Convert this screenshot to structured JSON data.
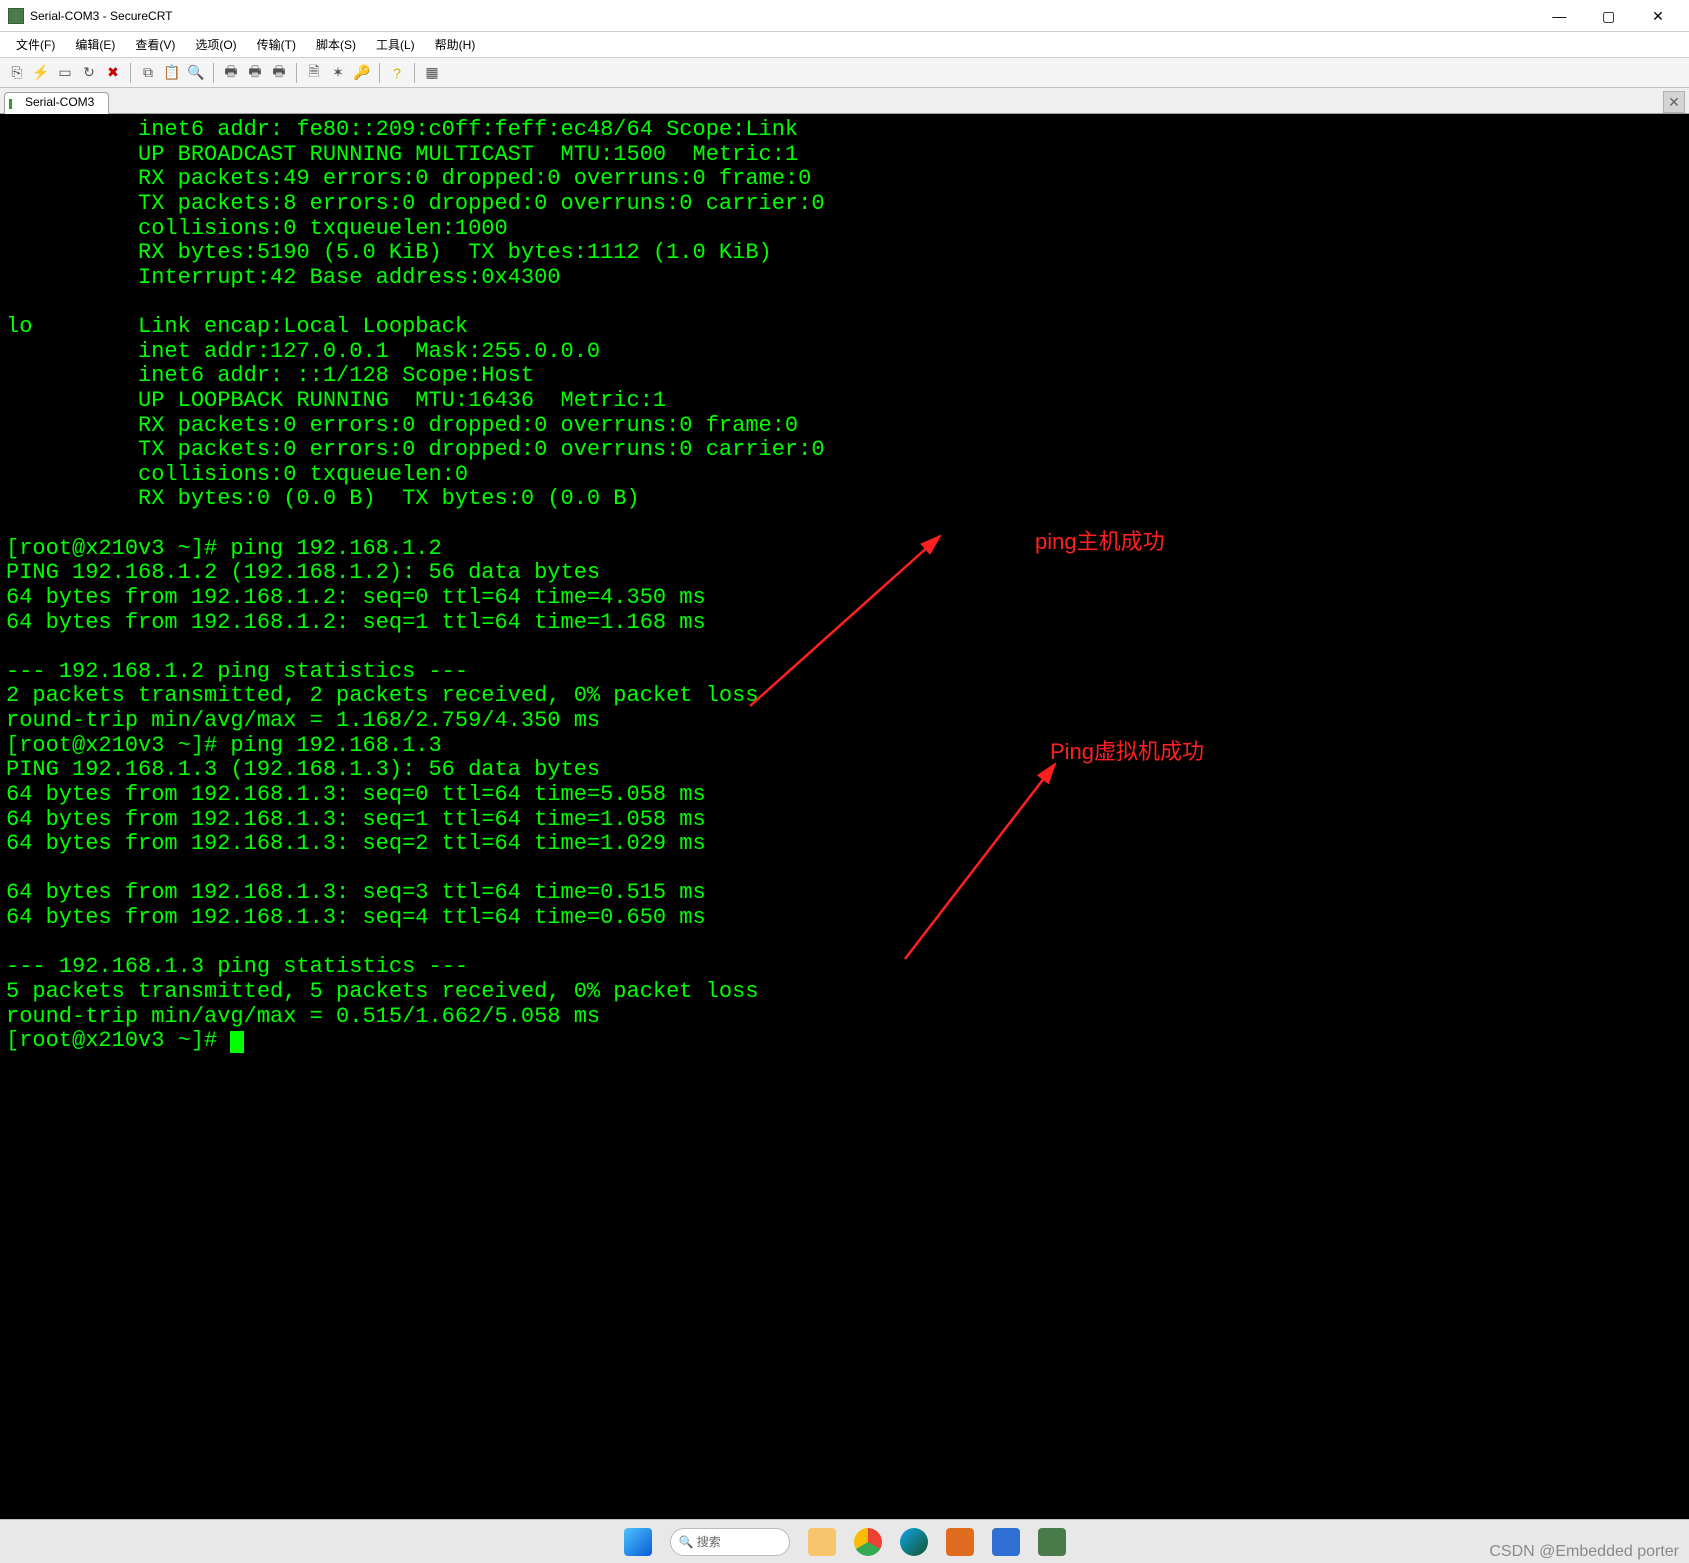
{
  "window": {
    "title": "Serial-COM3 - SecureCRT"
  },
  "menubar": [
    "文件(F)",
    "编辑(E)",
    "查看(V)",
    "选项(O)",
    "传输(T)",
    "脚本(S)",
    "工具(L)",
    "帮助(H)"
  ],
  "tab": {
    "label": "Serial-COM3"
  },
  "terminal_lines": [
    "          inet6 addr: fe80::209:c0ff:feff:ec48/64 Scope:Link",
    "          UP BROADCAST RUNNING MULTICAST  MTU:1500  Metric:1",
    "          RX packets:49 errors:0 dropped:0 overruns:0 frame:0",
    "          TX packets:8 errors:0 dropped:0 overruns:0 carrier:0",
    "          collisions:0 txqueuelen:1000",
    "          RX bytes:5190 (5.0 KiB)  TX bytes:1112 (1.0 KiB)",
    "          Interrupt:42 Base address:0x4300",
    "",
    "lo        Link encap:Local Loopback",
    "          inet addr:127.0.0.1  Mask:255.0.0.0",
    "          inet6 addr: ::1/128 Scope:Host",
    "          UP LOOPBACK RUNNING  MTU:16436  Metric:1",
    "          RX packets:0 errors:0 dropped:0 overruns:0 frame:0",
    "          TX packets:0 errors:0 dropped:0 overruns:0 carrier:0",
    "          collisions:0 txqueuelen:0",
    "          RX bytes:0 (0.0 B)  TX bytes:0 (0.0 B)",
    "",
    "[root@x210v3 ~]# ping 192.168.1.2",
    "PING 192.168.1.2 (192.168.1.2): 56 data bytes",
    "64 bytes from 192.168.1.2: seq=0 ttl=64 time=4.350 ms",
    "64 bytes from 192.168.1.2: seq=1 ttl=64 time=1.168 ms",
    "",
    "--- 192.168.1.2 ping statistics ---",
    "2 packets transmitted, 2 packets received, 0% packet loss",
    "round-trip min/avg/max = 1.168/2.759/4.350 ms",
    "[root@x210v3 ~]# ping 192.168.1.3",
    "PING 192.168.1.3 (192.168.1.3): 56 data bytes",
    "64 bytes from 192.168.1.3: seq=0 ttl=64 time=5.058 ms",
    "64 bytes from 192.168.1.3: seq=1 ttl=64 time=1.058 ms",
    "64 bytes from 192.168.1.3: seq=2 ttl=64 time=1.029 ms",
    "",
    "64 bytes from 192.168.1.3: seq=3 ttl=64 time=0.515 ms",
    "64 bytes from 192.168.1.3: seq=4 ttl=64 time=0.650 ms",
    "",
    "--- 192.168.1.3 ping statistics ---",
    "5 packets transmitted, 5 packets received, 0% packet loss",
    "round-trip min/avg/max = 0.515/1.662/5.058 ms",
    "[root@x210v3 ~]# "
  ],
  "annotations": {
    "a1": "ping主机成功",
    "a2": "Ping虚拟机成功"
  },
  "watermark": "CSDN @Embedded porter"
}
